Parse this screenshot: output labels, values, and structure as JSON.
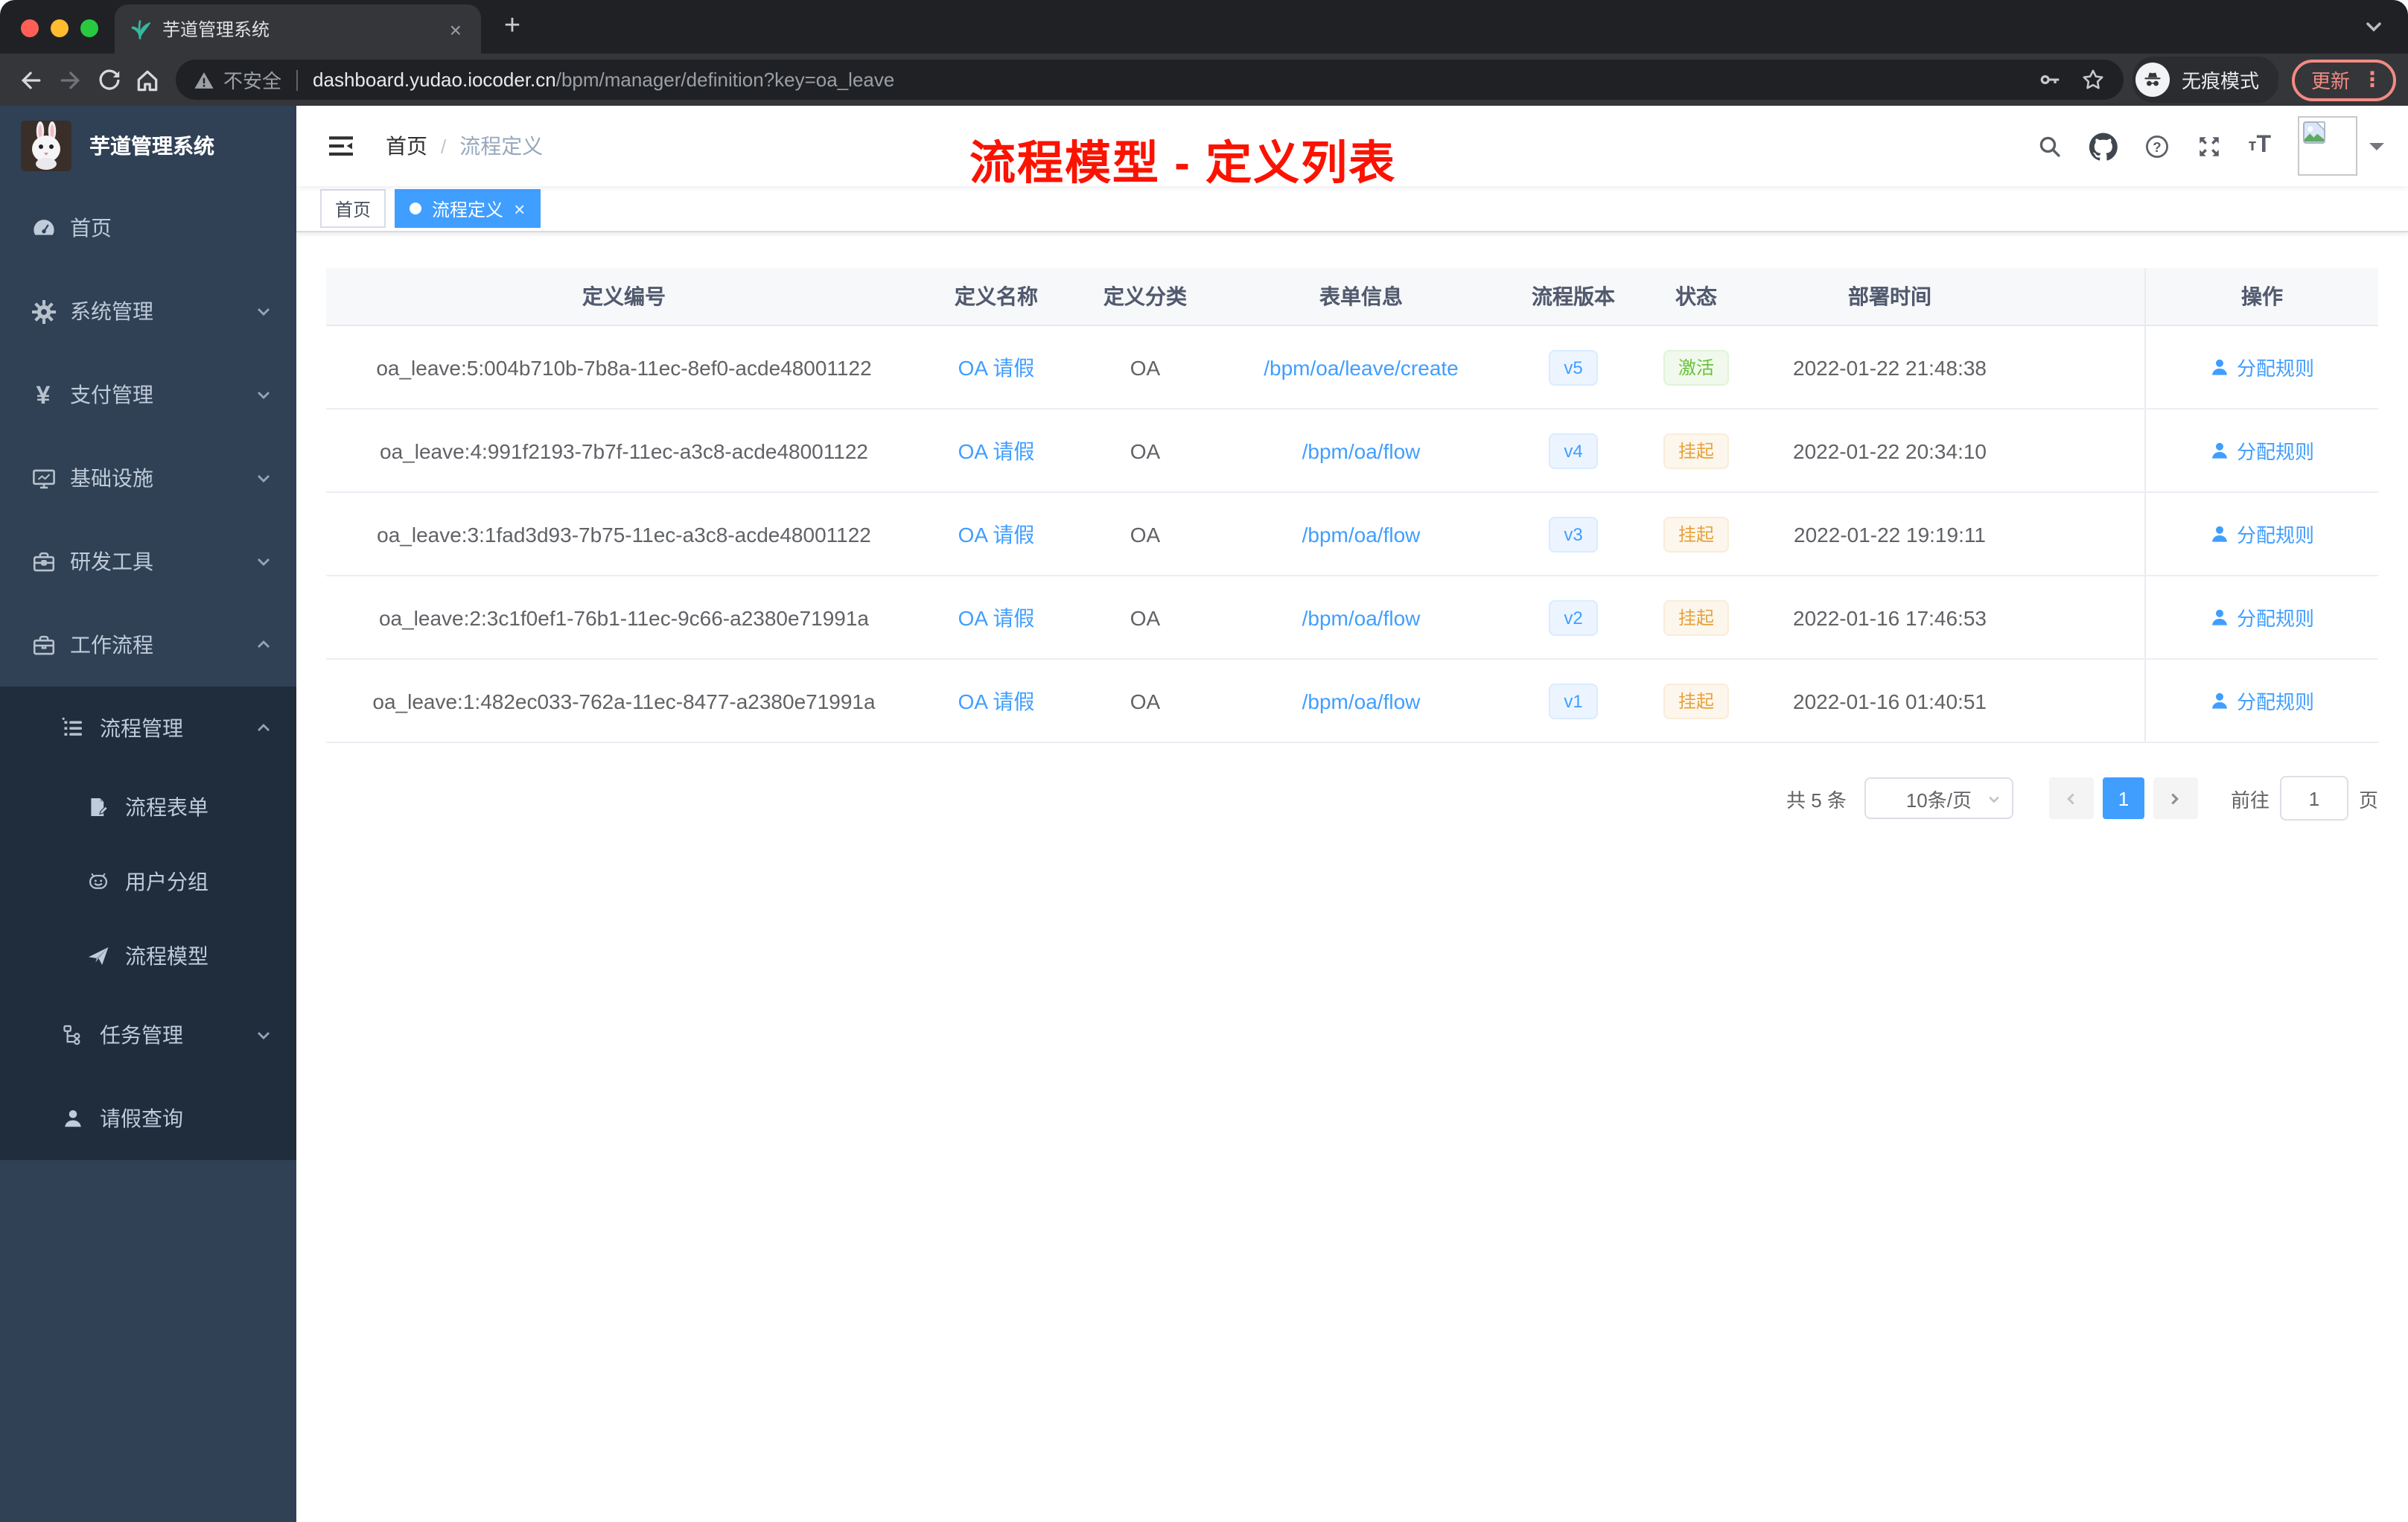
{
  "colors": {
    "accent_blue": "#409eff",
    "success_green": "#67c23a",
    "warning_orange": "#e6a23c",
    "annotation_red": "#fb1200",
    "sidebar_bg": "#304156",
    "submenu_bg": "#1f2d3d",
    "active_tag_bg": "#409eff",
    "update_pill": "#f28b82"
  },
  "browser": {
    "tab_title": "芋道管理系统",
    "tab_close": "×",
    "new_tab": "+",
    "security_label": "不安全",
    "url_host": "dashboard.yudao.iocoder.cn",
    "url_path": "/bpm/manager/definition?key=oa_leave",
    "incognito_label": "无痕模式",
    "update_label": "更新",
    "menu_dots": "⋮",
    "icons": [
      "back-icon",
      "forward-icon",
      "reload-icon",
      "home-icon",
      "warning-icon",
      "key-icon",
      "star-icon",
      "incognito-icon",
      "tab-search-chevron-icon"
    ]
  },
  "sidebar": {
    "app_title": "芋道管理系统",
    "logo": "rabbit-avatar",
    "items": [
      {
        "label": "首页",
        "icon": "dashboard-icon"
      },
      {
        "label": "系统管理",
        "icon": "gear-icon",
        "chevron": "down"
      },
      {
        "label": "支付管理",
        "icon": "yuan-icon",
        "chevron": "down"
      },
      {
        "label": "基础设施",
        "icon": "monitor-icon",
        "chevron": "down"
      },
      {
        "label": "研发工具",
        "icon": "toolbox-icon",
        "chevron": "down"
      },
      {
        "label": "工作流程",
        "icon": "briefcase-icon",
        "chevron": "up"
      }
    ],
    "submenu": [
      {
        "label": "流程管理",
        "icon": "list-icon",
        "chevron": "up",
        "level": 1
      },
      {
        "label": "流程表单",
        "icon": "form-icon",
        "level": 2
      },
      {
        "label": "用户分组",
        "icon": "robot-icon",
        "level": 2
      },
      {
        "label": "流程模型",
        "icon": "paper-plane-icon",
        "level": 2
      },
      {
        "label": "任务管理",
        "icon": "org-tree-icon",
        "chevron": "down",
        "level": 1
      },
      {
        "label": "请假查询",
        "icon": "user-icon",
        "level": 1
      }
    ]
  },
  "navbar": {
    "breadcrumb": {
      "home": "首页",
      "separator": "/",
      "current": "流程定义"
    },
    "icons": [
      "search-icon",
      "github-icon",
      "question-icon",
      "fullscreen-icon",
      "font-size-icon",
      "avatar-broken-image-icon",
      "caret-down-icon"
    ]
  },
  "annotation": {
    "text": "流程模型 - 定义列表"
  },
  "tags": {
    "home": "首页",
    "active": "流程定义",
    "close": "×"
  },
  "table": {
    "headers": [
      "定义编号",
      "定义名称",
      "定义分类",
      "表单信息",
      "流程版本",
      "状态",
      "部署时间",
      "操作"
    ],
    "rows": [
      {
        "id": "oa_leave:5:004b710b-7b8a-11ec-8ef0-acde48001122",
        "name": "OA 请假",
        "category": "OA",
        "form": "/bpm/oa/leave/create",
        "version": "v5",
        "status": "激活",
        "status_type": "success",
        "deploy_time": "2022-01-22 21:48:38",
        "action": "分配规则"
      },
      {
        "id": "oa_leave:4:991f2193-7b7f-11ec-a3c8-acde48001122",
        "name": "OA 请假",
        "category": "OA",
        "form": "/bpm/oa/flow",
        "version": "v4",
        "status": "挂起",
        "status_type": "warning",
        "deploy_time": "2022-01-22 20:34:10",
        "action": "分配规则"
      },
      {
        "id": "oa_leave:3:1fad3d93-7b75-11ec-a3c8-acde48001122",
        "name": "OA 请假",
        "category": "OA",
        "form": "/bpm/oa/flow",
        "version": "v3",
        "status": "挂起",
        "status_type": "warning",
        "deploy_time": "2022-01-22 19:19:11",
        "action": "分配规则"
      },
      {
        "id": "oa_leave:2:3c1f0ef1-76b1-11ec-9c66-a2380e71991a",
        "name": "OA 请假",
        "category": "OA",
        "form": "/bpm/oa/flow",
        "version": "v2",
        "status": "挂起",
        "status_type": "warning",
        "deploy_time": "2022-01-16 17:46:53",
        "action": "分配规则"
      },
      {
        "id": "oa_leave:1:482ec033-762a-11ec-8477-a2380e71991a",
        "name": "OA 请假",
        "category": "OA",
        "form": "/bpm/oa/flow",
        "version": "v1",
        "status": "挂起",
        "status_type": "warning",
        "deploy_time": "2022-01-16 01:40:51",
        "action": "分配规则"
      }
    ]
  },
  "pagination": {
    "total": "共 5 条",
    "page_size": "10条/页",
    "current": "1",
    "goto_label": "前往",
    "goto_value": "1",
    "unit": "页"
  }
}
